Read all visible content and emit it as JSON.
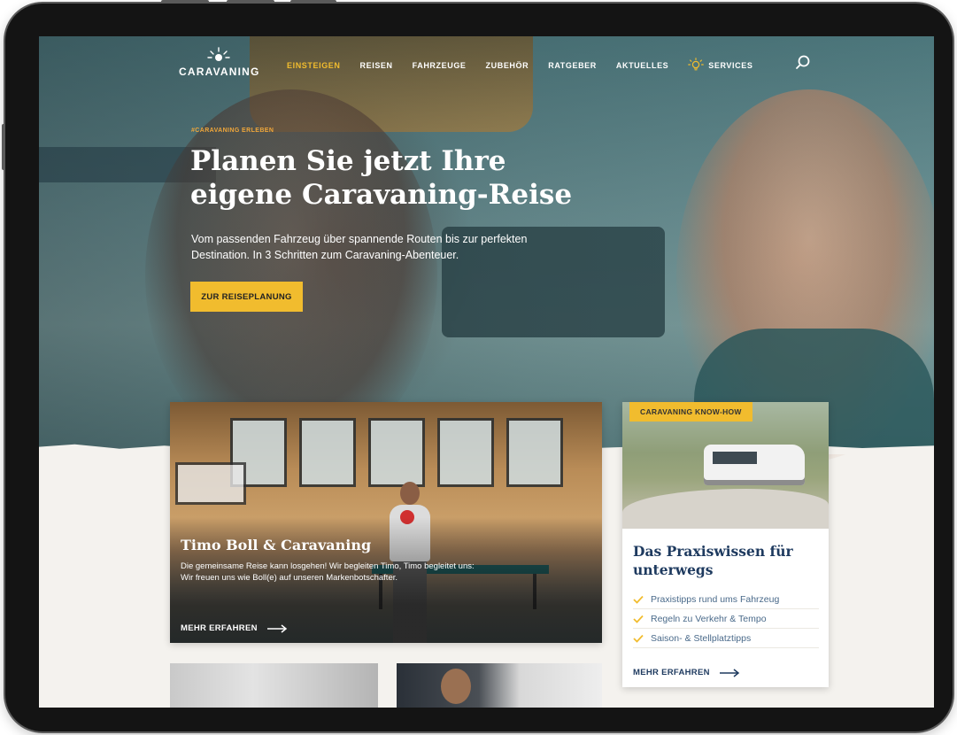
{
  "nav": {
    "logo_text": "CARAVANING",
    "items": [
      {
        "label": "EINSTEIGEN",
        "active": true
      },
      {
        "label": "REISEN"
      },
      {
        "label": "FAHRZEUGE"
      },
      {
        "label": "ZUBEHÖR"
      },
      {
        "label": "RATGEBER"
      },
      {
        "label": "AKTUELLES"
      },
      {
        "label": "SERVICES",
        "icon": "lightbulb-icon"
      }
    ],
    "search_icon": "search-icon"
  },
  "hero": {
    "tag": "#CARAVANING ERLEBEN",
    "title": "Planen Sie jetzt Ihre eigene Caravaning-Reise",
    "subtitle": "Vom passenden Fahrzeug über spannende Routen bis zur perfekten Destination. In 3 Schritten zum Caravaning-Abenteuer.",
    "cta_label": "ZUR REISEPLANUNG"
  },
  "featured_card": {
    "title": "Timo Boll & Caravaning",
    "text": "Die gemeinsame Reise kann losgehen! Wir begleiten Timo, Timo begleitet uns: Wir freuen uns wie Boll(e) auf unseren Markenbotschafter.",
    "link_label": "MEHR ERFAHREN"
  },
  "side_card": {
    "badge": "CARAVANING KNOW-HOW",
    "title": "Das Praxiswissen für unterwegs",
    "items": [
      "Praxistipps rund ums Fahrzeug",
      "Regeln zu Verkehr & Tempo",
      "Saison- & Stellplatztipps"
    ],
    "link_label": "MEHR ERFAHREN"
  },
  "colors": {
    "accent": "#f1bc2e",
    "navy": "#1e3a5f",
    "background": "#f4f2ee"
  }
}
